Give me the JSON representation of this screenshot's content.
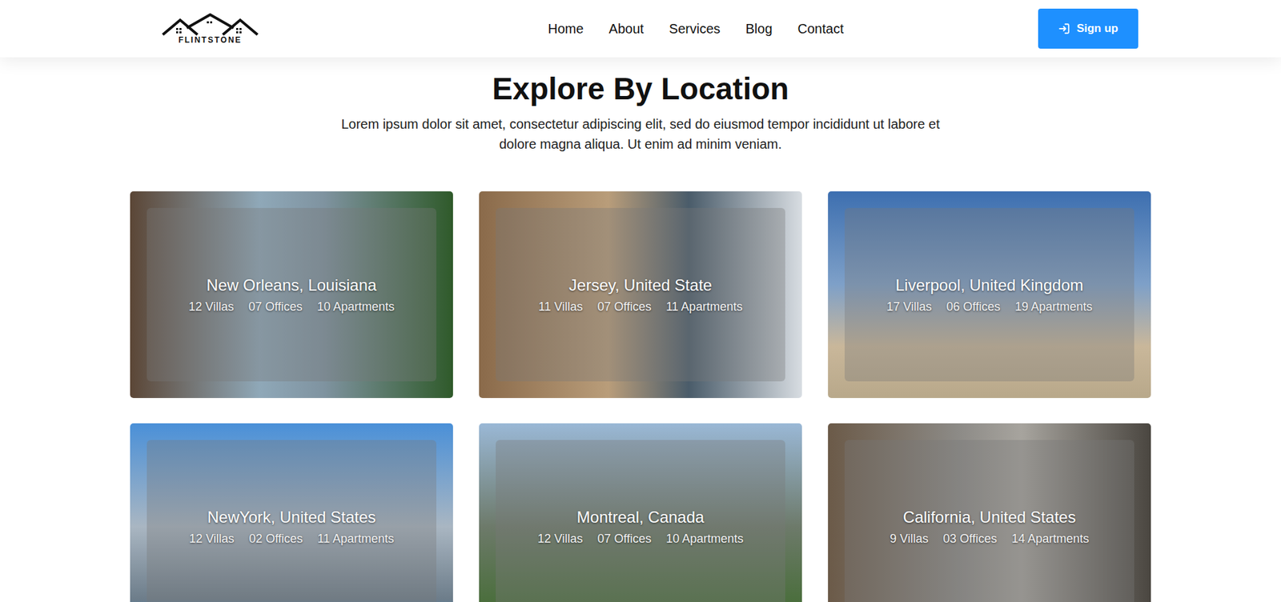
{
  "header": {
    "logo": "FLINTSTONE",
    "nav": [
      {
        "label": "Home",
        "selected": false
      },
      {
        "label": "About",
        "selected": false
      },
      {
        "label": "Services",
        "selected": false
      },
      {
        "label": "Blog",
        "selected": false
      },
      {
        "label": "Contact",
        "selected": false
      }
    ],
    "button": "Sign up"
  },
  "section": {
    "title": "Explore By Location",
    "subtitle": "Lorem ipsum dolor sit amet, consectetur adipiscing elit, sed do eiusmod tempor incididunt ut labore et dolore magna aliqua. Ut enim ad minim veniam."
  },
  "locations": [
    {
      "name": "New Orleans, Louisiana",
      "stats": [
        "12 Villas",
        "07 Offices",
        "10 Apartments"
      ]
    },
    {
      "name": "Jersey, United State",
      "stats": [
        "11 Villas",
        "07 Offices",
        "11 Apartments"
      ]
    },
    {
      "name": "Liverpool, United Kingdom",
      "stats": [
        "17 Villas",
        "06 Offices",
        "19 Apartments"
      ]
    },
    {
      "name": "NewYork, United States",
      "stats": [
        "12 Villas",
        "02 Offices",
        "11 Apartments"
      ]
    },
    {
      "name": "Montreal, Canada",
      "stats": [
        "12 Villas",
        "07 Offices",
        "10 Apartments"
      ]
    },
    {
      "name": "California, United States",
      "stats": [
        "9 Villas",
        "03 Offices",
        "14 Apartments"
      ]
    }
  ]
}
